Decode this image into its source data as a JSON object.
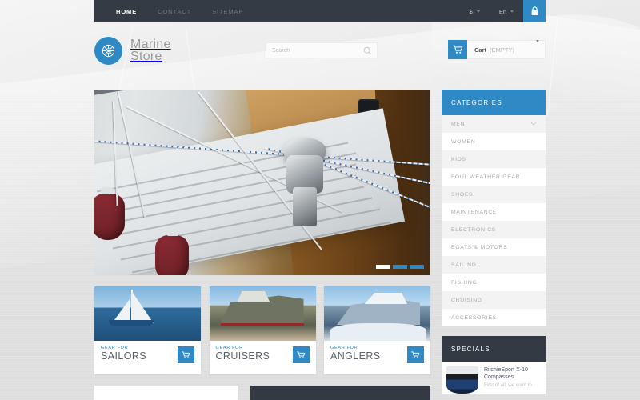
{
  "topbar": {
    "nav": [
      {
        "label": "HOME",
        "active": true
      },
      {
        "label": "CONTACT",
        "active": false
      },
      {
        "label": "SITEMAP",
        "active": false
      }
    ],
    "currency": "$",
    "language": "En",
    "lock_icon": "lock-icon"
  },
  "header": {
    "logo_icon": "ship-wheel-icon",
    "logo_line1": "Marine",
    "logo_line2": "Store",
    "search_placeholder": "Search",
    "search_value": "",
    "search_icon": "search-icon",
    "cart_icon": "shopping-cart-icon",
    "cart_label": "Cart",
    "cart_status": "(EMPTY)"
  },
  "slider": {
    "slides": [
      {
        "index": 1,
        "active": true
      },
      {
        "index": 2,
        "active": false
      },
      {
        "index": 3,
        "active": false
      }
    ]
  },
  "promos": [
    {
      "kicker": "GEAR FOR",
      "title": "SAILORS",
      "cart_icon": "shopping-cart-icon"
    },
    {
      "kicker": "GEAR FOR",
      "title": "CRUISERS",
      "cart_icon": "shopping-cart-icon"
    },
    {
      "kicker": "GEAR FOR",
      "title": "ANGLERS",
      "cart_icon": "shopping-cart-icon"
    }
  ],
  "sidebar": {
    "categories_title": "CATEGORIES",
    "categories": [
      {
        "label": "MEN",
        "has_children": true
      },
      {
        "label": "WOMEN",
        "has_children": false
      },
      {
        "label": "KIDS",
        "has_children": false
      },
      {
        "label": "FOUL WEATHER GEAR",
        "has_children": false
      },
      {
        "label": "SHOES",
        "has_children": false
      },
      {
        "label": "MAINTENANCE",
        "has_children": false
      },
      {
        "label": "ELECTRONICS",
        "has_children": false
      },
      {
        "label": "BOATS & MOTORS",
        "has_children": false
      },
      {
        "label": "SAILING",
        "has_children": false
      },
      {
        "label": "FISHING",
        "has_children": false
      },
      {
        "label": "CRUISING",
        "has_children": false
      },
      {
        "label": "ACCESSORIES",
        "has_children": false
      }
    ],
    "specials_title": "SPECIALS",
    "special_product": {
      "name": "RitchieSport X-10 Compasses",
      "description": "First of all, we want to"
    }
  },
  "colors": {
    "accent_blue": "#2f89c4",
    "dark": "#343a44",
    "topbar": "#353b45",
    "page_bg": "#e6e6e6",
    "row_alt": "#f3f3f3"
  }
}
